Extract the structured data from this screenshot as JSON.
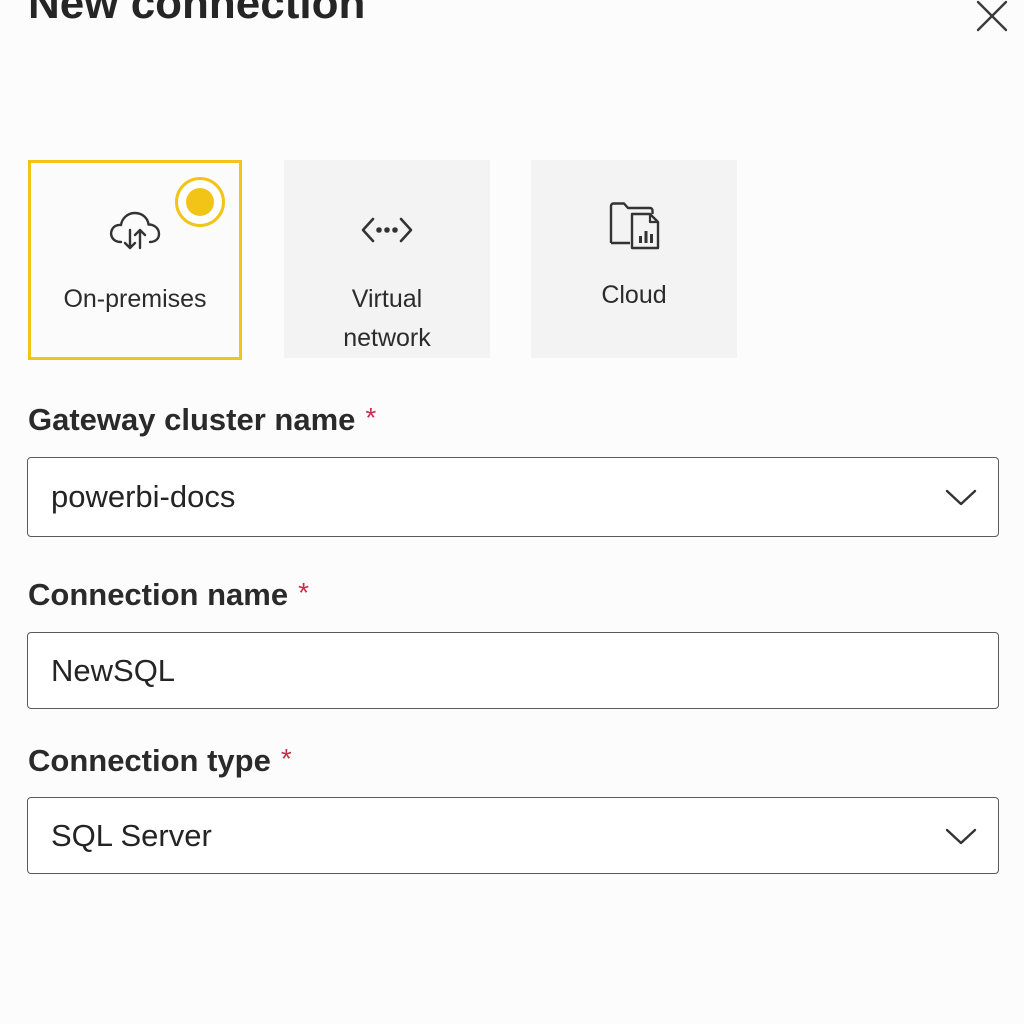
{
  "dialog": {
    "title": "New connection",
    "close_icon": "close-icon"
  },
  "connection_options": [
    {
      "label": "On-premises",
      "icon": "cloud-upload-download-icon",
      "selected": true
    },
    {
      "label": "Virtual\nnetwork",
      "icon": "code-arrows-icon",
      "selected": false
    },
    {
      "label": "Cloud",
      "icon": "folder-report-icon",
      "selected": false
    }
  ],
  "fields": {
    "gateway_cluster_name": {
      "label": "Gateway cluster name",
      "required_marker": "*",
      "value": "powerbi-docs"
    },
    "connection_name": {
      "label": "Connection name",
      "required_marker": "*",
      "value": "NewSQL"
    },
    "connection_type": {
      "label": "Connection type",
      "required_marker": "*",
      "value": "SQL Server"
    }
  },
  "colors": {
    "accent": "#f2c417",
    "required": "#c4314b",
    "card_bg": "#f3f3f3"
  }
}
